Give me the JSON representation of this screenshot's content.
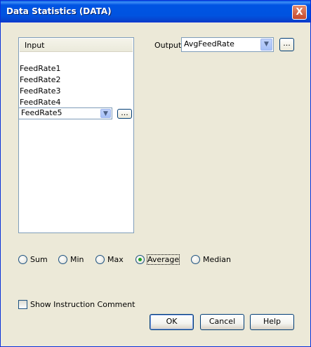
{
  "window": {
    "title": "Data Statistics (DATA)",
    "close_symbol": "X"
  },
  "input": {
    "header": "Input",
    "items": [
      "FeedRate1",
      "FeedRate2",
      "FeedRate3",
      "FeedRate4"
    ],
    "combo_value": "FeedRate5",
    "browse_label": "..."
  },
  "output": {
    "label": "Output",
    "value": "AvgFeedRate",
    "browse_label": "..."
  },
  "operations": {
    "options": [
      "Sum",
      "Min",
      "Max",
      "Average",
      "Median"
    ],
    "selected": "Average"
  },
  "show_comment": {
    "label": "Show Instruction Comment",
    "checked": false
  },
  "buttons": {
    "ok": "OK",
    "cancel": "Cancel",
    "help": "Help"
  },
  "colors": {
    "titlebar": "#0054e3",
    "dialog_bg": "#ece9d8",
    "radio_dot": "#21a121"
  }
}
